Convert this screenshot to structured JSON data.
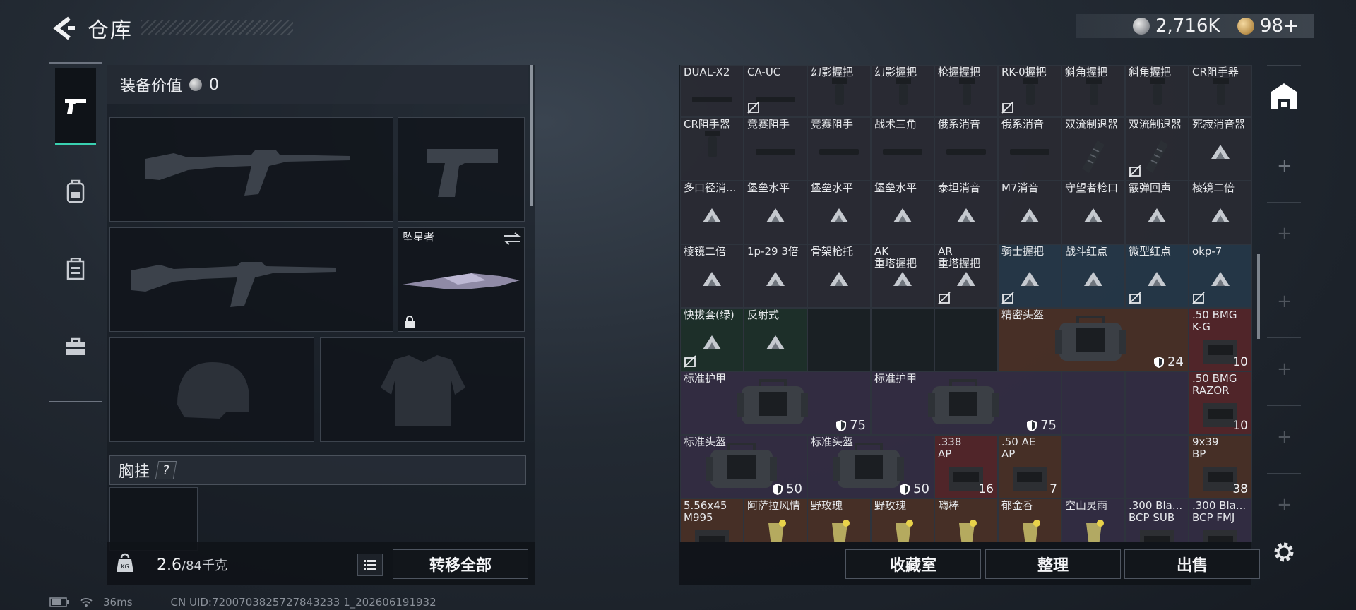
{
  "header": {
    "title": "仓库"
  },
  "currency": {
    "silver": "2,716K",
    "gold": "98+"
  },
  "left_panel": {
    "equip_value_label": "装备价值",
    "equip_value": "0",
    "melee_name": "坠星者",
    "chest_label": "胸挂",
    "chest_help": "?",
    "weight_current": "2.6",
    "weight_capacity": "/84千克",
    "transfer_all": "转移全部"
  },
  "grid": {
    "row0": [
      "DUAL-X2",
      "CA-UC",
      "幻影握把",
      "幻影握把",
      "枪握握把",
      "RK-0握把",
      "斜角握把",
      "斜角握把",
      "CR阻手器"
    ],
    "row1": [
      "CR阻手器",
      "竞赛阻手",
      "竞赛阻手",
      "战术三角",
      "俄系消音",
      "俄系消音",
      "双流制退器",
      "双流制退器",
      "死寂消音器"
    ],
    "row2": [
      "多口径消...",
      "堡垒水平",
      "堡垒水平",
      "堡垒水平",
      "泰坦消音",
      "M7消音",
      "守望者枪口",
      "霰弹回声",
      "棱镜二倍"
    ],
    "row3": [
      "棱镜二倍",
      "1p-29 3倍",
      "骨架枪托",
      "AK\n重塔握把",
      "AR\n重塔握把",
      "骑士握把",
      "战斗红点",
      "微型红点",
      "okp-7"
    ],
    "row4": [
      "快拔套(绿)",
      "反射式"
    ],
    "helmet_precision": {
      "label": "精密头盔",
      "durability": "24"
    },
    "ammo_bmg_k": {
      "label": ".50 BMG\nK-G",
      "count": "10"
    },
    "armor1": {
      "label": "标准护甲",
      "durability": "75"
    },
    "armor2": {
      "label": "标准护甲",
      "durability": "75"
    },
    "ammo_bmg_r": {
      "label": ".50 BMG\nRAZOR",
      "count": "10"
    },
    "helmet1": {
      "label": "标准头盔",
      "durability": "50"
    },
    "helmet2": {
      "label": "标准头盔",
      "durability": "50"
    },
    "ammo_338": {
      "label": ".338\nAP",
      "count": "16"
    },
    "ammo_50ae": {
      "label": ".50 AE\nAP",
      "count": "7"
    },
    "ammo_939": {
      "label": "9x39\nBP",
      "count": "38"
    },
    "row7": [
      "5.56x45\nM995",
      "阿萨拉风情",
      "野玫瑰",
      "野玫瑰",
      "嗨棒",
      "郁金香",
      "空山灵雨",
      ".300 Bla...\nBCP SUB",
      ".300 Bla...\nBCP FMJ"
    ]
  },
  "right_panel": {
    "collection_btn": "收藏室",
    "sort_btn": "整理",
    "sell_btn": "出售"
  },
  "footer": {
    "ping": "36ms",
    "uid": "CN UID:7200703825727843233 1_202606191932"
  },
  "colors": {
    "accent": "#3ad1b1",
    "blue_rarity": "#283c4e",
    "orange_rarity": "#503428",
    "red_rarity": "#5c282c",
    "purple_rarity": "#373048"
  }
}
